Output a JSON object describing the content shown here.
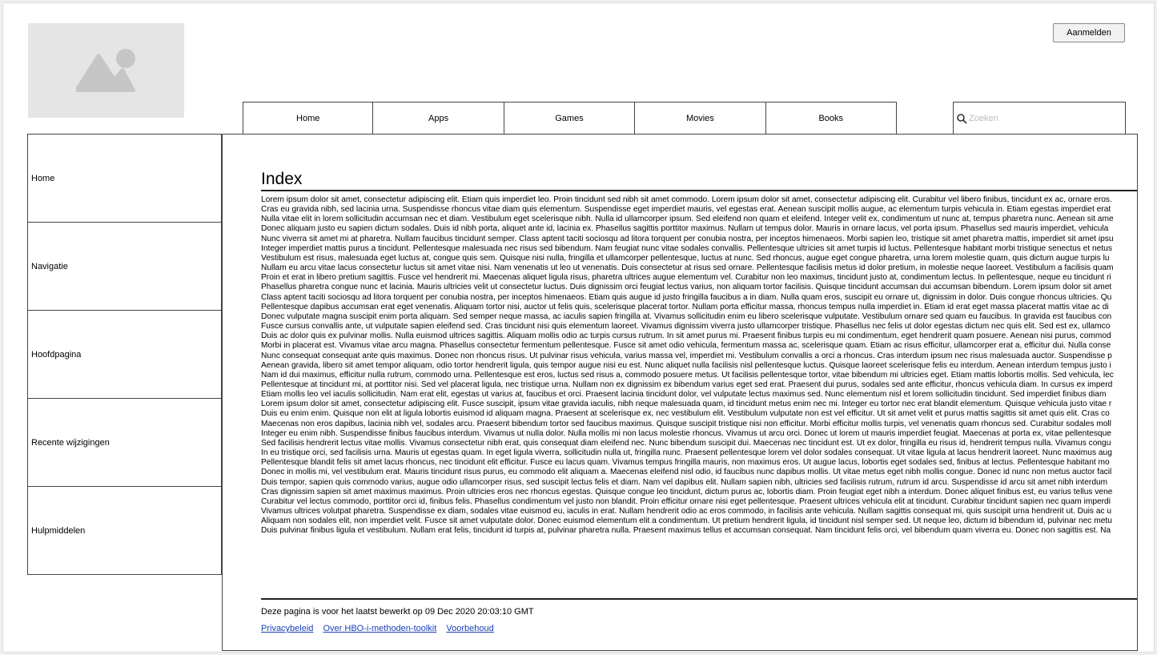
{
  "header": {
    "login_label": "Aanmelden"
  },
  "topnav": {
    "tabs": [
      {
        "label": "Home"
      },
      {
        "label": "Apps"
      },
      {
        "label": "Games"
      },
      {
        "label": "Movies"
      },
      {
        "label": "Books"
      }
    ]
  },
  "search": {
    "placeholder": "Zoeken",
    "icon": "search-icon"
  },
  "sidebar": {
    "items": [
      {
        "label": "Home"
      },
      {
        "label": "Navigatie"
      },
      {
        "label": "Hoofdpagina"
      },
      {
        "label": "Recente wijzigingen"
      },
      {
        "label": "Hulpmiddelen"
      }
    ]
  },
  "main": {
    "title": "Index",
    "lines": [
      "Lorem ipsum dolor sit amet, consectetur adipiscing elit. Etiam quis imperdiet leo. Proin tincidunt sed nibh sit amet commodo. Lorem ipsum dolor sit amet, consectetur adipiscing elit. Curabitur vel libero finibus, tincidunt ex ac, ornare eros.",
      "Cras eu gravida nibh, sed lacinia urna. Suspendisse rhoncus vitae diam quis elementum. Suspendisse eget imperdiet mauris, vel egestas erat. Aenean suscipit mollis augue, ac elementum turpis vehicula in. Etiam egestas imperdiet erat",
      "Nulla vitae elit in lorem sollicitudin accumsan nec et diam. Vestibulum eget scelerisque nibh. Nulla id ullamcorper ipsum. Sed eleifend non quam et eleifend. Integer velit ex, condimentum ut nunc at, tempus pharetra nunc. Aenean sit ame",
      "Donec aliquam justo eu sapien dictum sodales. Duis id nibh porta, aliquet ante id, lacinia ex. Phasellus sagittis porttitor maximus. Nullam ut tempus dolor. Mauris in ornare lacus, vel porta ipsum. Phasellus sed mauris imperdiet, vehicula",
      "Nunc viverra sit amet mi at pharetra. Nullam faucibus tincidunt semper. Class aptent taciti sociosqu ad litora torquent per conubia nostra, per inceptos himenaeos. Morbi sapien leo, tristique sit amet pharetra mattis, imperdiet sit amet ipsu",
      "Integer imperdiet mattis purus a tincidunt. Pellentesque malesuada nec risus sed bibendum. Nam feugiat nunc vitae sodales convallis. Pellentesque ultricies sit amet turpis id luctus. Pellentesque habitant morbi tristique senectus et netus",
      "Vestibulum est risus, malesuada eget luctus at, congue quis sem. Quisque nisi nulla, fringilla et ullamcorper pellentesque, luctus at nunc. Sed rhoncus, augue eget congue pharetra, urna lorem molestie quam, quis dictum augue turpis lu",
      "Nullam eu arcu vitae lacus consectetur luctus sit amet vitae nisi. Nam venenatis ut leo ut venenatis. Duis consectetur at risus sed ornare. Pellentesque facilisis metus id dolor pretium, in molestie neque laoreet. Vestibulum a facilisis quam",
      "Proin et erat in libero pretium sagittis. Fusce vel hendrerit mi. Maecenas aliquet ligula risus, pharetra ultrices augue elementum vel. Curabitur non leo maximus, tincidunt justo at, condimentum lectus. In pellentesque, neque eu tincidunt ri",
      "Phasellus pharetra congue nunc et lacinia. Mauris ultricies velit ut consectetur luctus. Duis dignissim orci feugiat lectus varius, non aliquam tortor facilisis. Quisque tincidunt accumsan dui accumsan bibendum. Lorem ipsum dolor sit amet",
      "Class aptent taciti sociosqu ad litora torquent per conubia nostra, per inceptos himenaeos. Etiam quis augue id justo fringilla faucibus a in diam. Nulla quam eros, suscipit eu ornare ut, dignissim in dolor. Duis congue rhoncus ultricies. Qu",
      "Pellentesque dapibus accumsan erat eget venenatis. Aliquam tortor nisi, auctor ut felis quis, scelerisque placerat tortor. Nullam porta efficitur massa, rhoncus tempus nulla imperdiet in. Etiam id erat eget massa placerat mattis vitae ac di",
      "Donec vulputate magna suscipit enim porta aliquam. Sed semper neque massa, ac iaculis sapien fringilla at. Vivamus sollicitudin enim eu libero scelerisque vulputate. Vestibulum ornare sed quam eu faucibus. In gravida est faucibus con",
      "Fusce cursus convallis ante, ut vulputate sapien eleifend sed. Cras tincidunt nisi quis elementum laoreet. Vivamus dignissim viverra justo ullamcorper tristique. Phasellus nec felis ut dolor egestas dictum nec quis elit. Sed est ex, ullamco",
      "Duis ac dolor quis ex pulvinar mollis. Nulla euismod ultrices sagittis. Aliquam mollis odio ac turpis cursus rutrum. In sit amet purus mi. Praesent finibus turpis eu mi condimentum, eget hendrerit quam posuere. Aenean nisi purus, commod",
      "Morbi in placerat est. Vivamus vitae arcu magna. Phasellus consectetur fermentum pellentesque. Fusce sit amet odio vehicula, fermentum massa ac, scelerisque quam. Etiam ac risus efficitur, ullamcorper erat a, efficitur dui. Nulla conse",
      "Nunc consequat consequat ante quis maximus. Donec non rhoncus risus. Ut pulvinar risus vehicula, varius massa vel, imperdiet mi. Vestibulum convallis a orci a rhoncus. Cras interdum ipsum nec risus malesuada auctor. Suspendisse p",
      "Aenean gravida, libero sit amet tempor aliquam, odio tortor hendrerit ligula, quis tempor augue nisi eu est. Nunc aliquet nulla facilisis nisl pellentesque luctus. Quisque laoreet scelerisque felis eu interdum. Aenean interdum tempus justo i",
      "Nam id dui maximus, efficitur nulla rutrum, commodo urna. Pellentesque est eros, luctus sed risus a, commodo posuere metus. Ut facilisis pellentesque tortor, vitae bibendum mi ultricies eget. Etiam mattis lobortis mollis. Sed vehicula, lec",
      "Pellentesque at tincidunt mi, at porttitor nisi. Sed vel placerat ligula, nec tristique urna. Nullam non ex dignissim ex bibendum varius eget sed erat. Praesent dui purus, sodales sed ante efficitur, rhoncus vehicula diam. In cursus ex imperd",
      "Etiam mollis leo vel iaculis sollicitudin. Nam erat elit, egestas ut varius at, faucibus et orci. Praesent lacinia tincidunt dolor, vel vulputate lectus maximus sed. Nunc elementum nisl et lorem sollicitudin tincidunt. Sed imperdiet finibus diam",
      "Lorem ipsum dolor sit amet, consectetur adipiscing elit. Fusce suscipit, ipsum vitae gravida iaculis, nibh neque malesuada quam, id tincidunt metus enim nec mi. Integer eu tortor nec erat blandit elementum. Quisque vehicula justo vitae r",
      "Duis eu enim enim. Quisque non elit at ligula lobortis euismod id aliquam magna. Praesent at scelerisque ex, nec vestibulum elit. Vestibulum vulputate non est vel efficitur. Ut sit amet velit et purus mattis sagittis sit amet quis elit. Cras co",
      "Maecenas non eros dapibus, lacinia nibh vel, sodales arcu. Praesent bibendum tortor sed faucibus maximus. Quisque suscipit tristique nisi non efficitur. Morbi efficitur mollis turpis, vel venenatis quam rhoncus sed. Curabitur sodales moll",
      "Integer eu enim nibh. Suspendisse finibus faucibus interdum. Vivamus ut nulla dolor. Nulla mollis mi non lacus molestie rhoncus. Vivamus ut arcu orci. Donec ut lorem ut mauris imperdiet feugiat. Maecenas at porta ex, vitae pellentesque",
      "Sed facilisis hendrerit lectus vitae mollis. Vivamus consectetur nibh erat, quis consequat diam eleifend nec. Nunc bibendum suscipit dui. Maecenas nec tincidunt est. Ut ex dolor, fringilla eu risus id, hendrerit tempus nulla. Vivamus congu",
      "In eu tristique orci, sed facilisis urna. Mauris ut egestas quam. In eget ligula viverra, sollicitudin nulla ut, fringilla nunc. Praesent pellentesque lorem vel dolor sodales consequat. Ut vitae ligula at lacus hendrerit laoreet. Nunc maximus aug",
      "Pellentesque blandit felis sit amet lacus rhoncus, nec tincidunt elit efficitur. Fusce eu lacus quam. Vivamus tempus fringilla mauris, non maximus eros. Ut augue lacus, lobortis eget sodales sed, finibus at lectus. Pellentesque habitant mo",
      "Donec in mollis mi, vel vestibulum erat. Mauris tincidunt risus purus, eu commodo elit aliquam a. Maecenas eleifend nisl odio, id faucibus nunc dapibus mollis. Ut vitae metus eget nibh mollis congue. Donec id nunc non metus auctor facil",
      "Duis tempor, sapien quis commodo varius, augue odio ullamcorper risus, sed suscipit lectus felis et diam. Nam vel dapibus elit. Nullam sapien nibh, ultricies sed facilisis rutrum, rutrum id arcu. Suspendisse id arcu sit amet nibh interdum",
      "Cras dignissim sapien sit amet maximus maximus. Proin ultricies eros nec rhoncus egestas. Quisque congue leo tincidunt, dictum purus ac, lobortis diam. Proin feugiat eget nibh a interdum. Donec aliquet finibus est, eu varius tellus vene",
      "Curabitur vel lectus commodo, porttitor orci id, finibus felis. Phasellus condimentum vel justo non blandit. Proin efficitur ornare nisi eget pellentesque. Praesent ultrices vehicula elit at tincidunt. Curabitur tincidunt sapien nec quam imperdi",
      "Vivamus ultrices volutpat pharetra. Suspendisse ex diam, sodales vitae euismod eu, iaculis in erat. Nullam hendrerit odio ac eros commodo, in facilisis ante vehicula. Nullam sagittis consequat mi, quis suscipit urna hendrerit ut. Duis ac u",
      "Aliquam non sodales elit, non imperdiet velit. Fusce sit amet vulputate dolor. Donec euismod elementum elit a condimentum. Ut pretium hendrerit ligula, id tincidunt nisl semper sed. Ut neque leo, dictum id bibendum id, pulvinar nec metu",
      "Duis pulvinar finibus ligula et vestibulum. Nullam erat felis, tincidunt id turpis at, pulvinar pharetra nulla. Praesent maximus tellus et accumsan consequat. Nam tincidunt felis orci, vel bibendum quam viverra eu. Donec non sagittis est. Na"
    ],
    "last_edited": "Deze pagina is voor het laatst bewerkt op 09 Dec 2020 20:03:10 GMT",
    "footer_links": [
      {
        "label": "Privacybeleid"
      },
      {
        "label": "Over HBO-i-methoden-toolkit"
      },
      {
        "label": "Voorbehoud"
      }
    ]
  }
}
